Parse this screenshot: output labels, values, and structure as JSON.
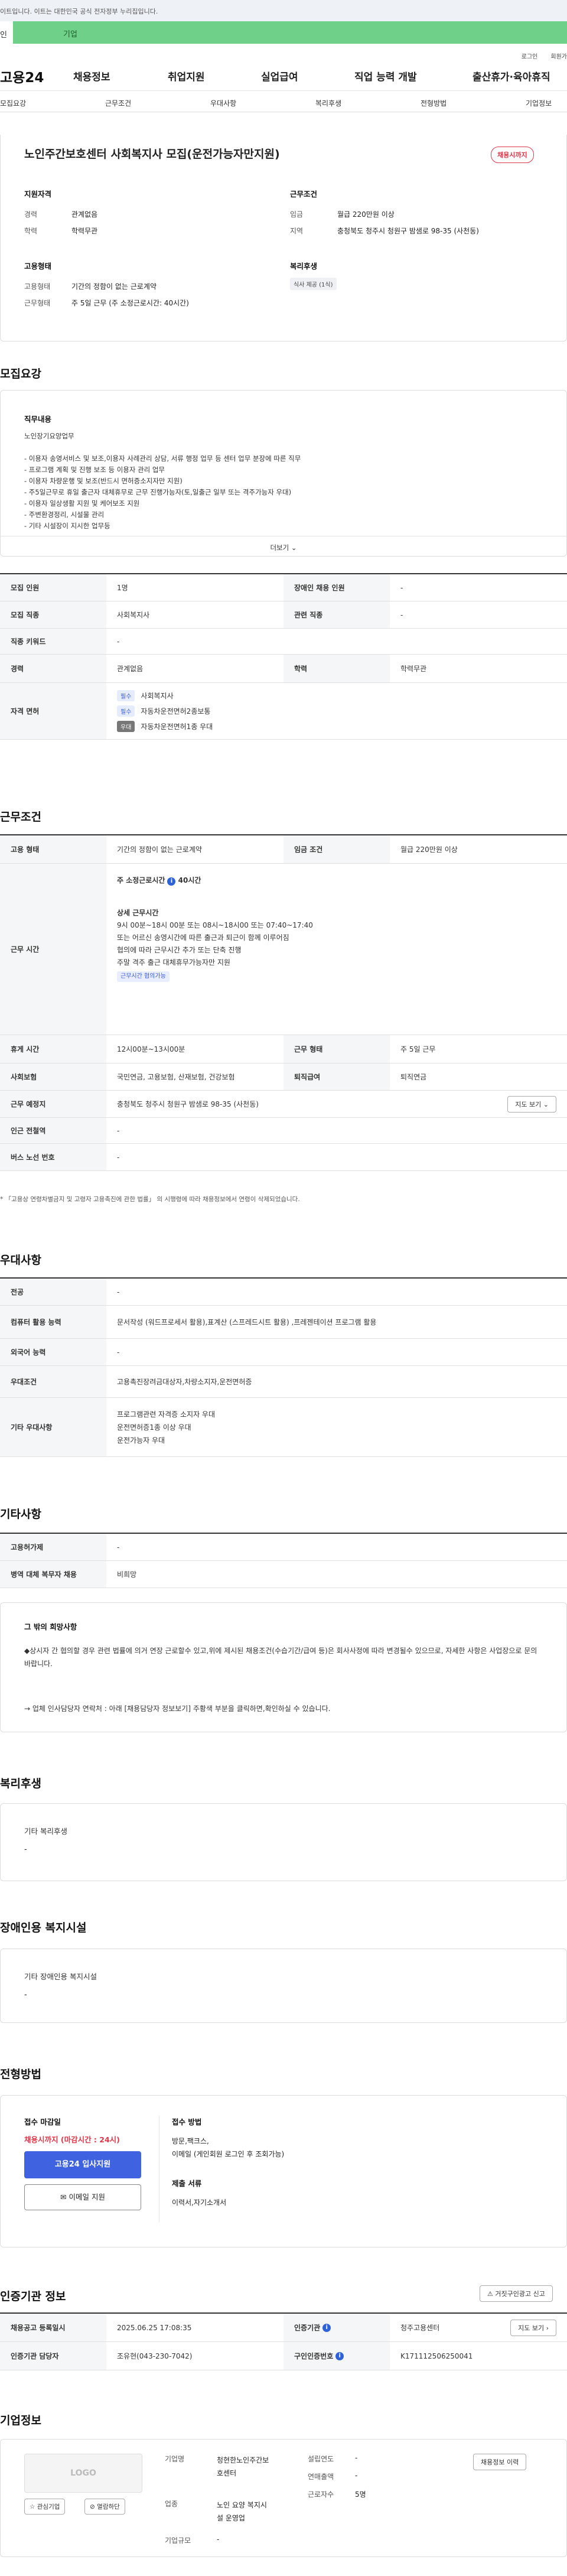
{
  "gov_notice": "이트입니다. 이트는 대한민국 공식 전자정부 누리집입니다.",
  "tabs": [
    "인",
    "기업"
  ],
  "util": [
    "로그인",
    "회원가"
  ],
  "logo": "고용24",
  "menu": [
    "채용정보",
    "취업지원",
    "실업급여",
    "직업 능력 개발",
    "출산휴가·육아휴직"
  ],
  "subnav": [
    "모집요강",
    "근무조건",
    "우대사항",
    "복리후생",
    "전형방법",
    "기업정보"
  ],
  "job": {
    "title": "노인주간보호센터 사회복지사 모집(운전가능자만지원)",
    "badge": "채용시까지",
    "qual_title": "지원자격",
    "career_label": "경력",
    "career": "관계없음",
    "edu_label": "학력",
    "edu": "학력무관",
    "emp_title": "고용형태",
    "emp_label": "고용형태",
    "emp": "기간의 정함이 없는 근로계약",
    "work_label": "근무형태",
    "work": "주 5일 근무 (주 소정근로시간: 40시간)",
    "cond_title": "근무조건",
    "wage_label": "임금",
    "wage": "월급 220만원 이상",
    "loc_label": "지역",
    "loc": "충청북도 청주시 청원구 밤샘로 98-35 (사천동)",
    "welfare_title": "복리후생",
    "welfare_tag": "식사 제공 (1식)"
  },
  "s_recruit": "모집요강",
  "duty": {
    "title": "직무내용",
    "lines": [
      "노인장기요양업무",
      "- 이용자 송영서비스 및 보조,이용자 사례관리 상담, 서류 행정 업무 등 센터 업무 분장에 따른 직무",
      "- 프로그램 계획 및 진행 보조 등 이용자 관리 업무",
      "- 이용자 차량운행 및 보조(반드시 면허증소지자만 지원)",
      "- 주5일근무로 휴일 출근자 대체휴무로 근무 진행가능자(토,일출근 일부 또는 격주가능자 우대)",
      "- 이용자 일상생활 지원 및 케어보조 지원",
      "- 주변환경정리, 시설물 관리",
      "- 기타 시설장이 지시한 업무등"
    ],
    "more": "더보기"
  },
  "req": {
    "count_l": "모집 인원",
    "count": "1명",
    "dis_l": "장애인 채용 인원",
    "dis": "-",
    "job_l": "모집 직종",
    "job": "사회복지사",
    "rel_l": "관련 직종",
    "rel": "-",
    "kw_l": "직종 키워드",
    "kw": "-",
    "car_l": "경력",
    "car": "관계없음",
    "edu_l": "학력",
    "edu": "학력무관",
    "lic_l": "자격 면허",
    "lic": [
      {
        "tag": "필수",
        "name": "사회복지사"
      },
      {
        "tag": "필수",
        "name": "자동차운전면허2종보통"
      },
      {
        "tag": "우대",
        "name": "자동차운전면허1종 우대"
      }
    ]
  },
  "s_cond": "근무조건",
  "cond": {
    "emp_l": "고용 형태",
    "emp": "기간의 정함이 없는 근로계약",
    "wage_l": "임금 조건",
    "wage": "월급 220만원 이상",
    "time_l": "근무 시간",
    "hours_title": "주 소정근로시간",
    "hours_val": "40시간",
    "detail_title": "상세 근무시간",
    "detail": [
      "9시 00분~18시 00분 또는 08시~18시00 또는 07:40~17:40",
      "또는 어르신 송영시간에 따른 출근과 퇴근이 함께 이루어짐",
      "협의에 따라 근무시간 추가 또는 단축 진행",
      "주말 격주 출근 대체휴무가능자만 지원"
    ],
    "hours_tag": "근무시간 협의가능",
    "rest_l": "휴게 시간",
    "rest": "12시00분~13시00분",
    "form_l": "근무 형태",
    "form": "주 5일 근무",
    "ins_l": "사회보험",
    "ins": "국민연금, 고용보험, 산재보험, 건강보험",
    "ret_l": "퇴직급여",
    "ret": "퇴직연금",
    "place_l": "근무 예정지",
    "place": "충청북도 청주시 청원구 밤샘로 98-35 (사천동)",
    "map": "지도 보기",
    "sub_l": "인근 전철역",
    "sub": "-",
    "bus_l": "버스 노선 번호",
    "bus": "-",
    "note": "* 「고용상 연령차별금지 및 고령자 고용촉진에 관한 법률」 의 시행령에 따라 채용정보에서 연령이 삭제되었습니다."
  },
  "s_pref": "우대사항",
  "pref": {
    "major_l": "전공",
    "major": "-",
    "pc_l": "컴퓨터 활용 능력",
    "pc": "문서작성 (워드프로세서 활용),표계산 (스프레드시트 활용) ,프레젠테이션 프로그램 활용",
    "lang_l": "외국어 능력",
    "lang": "-",
    "cond_l": "우대조건",
    "cond": "고용촉진장려금대상자,차량소지자,운전면허증",
    "etc_l": "기타 우대사항",
    "etc": [
      "프로그램관련 자격증 소지자 우대",
      "운전면허증1종 이상 우대",
      "운전가능자 우대"
    ]
  },
  "s_etc": "기타사항",
  "etc": {
    "ins_l": "고용허가제",
    "ins": "-",
    "mil_l": "병역 대체 복무자 채용",
    "mil": "비희망",
    "wish_title": "그 밖의 희망사항",
    "wish1": "◆상시자 간 협의할 경우 관련 법률에 의거 연장 근로할수 있고,위에 제시된 채용조건(수습기간/급여 등)은 회사사정에 따라 변경될수 있으므로, 자세한 사항은 사업장으로 문의 바랍니다.",
    "wish2": "→ 업체 인사담당자 연락처 :  아래 [채용담당자 정보보기] 주황색 부분을 클릭하면,확인하실 수 있습니다."
  },
  "s_welf": "복리후생",
  "welf": {
    "title": "기타 복리후생",
    "val": "-"
  },
  "s_dis": "장애인용 복지시설",
  "dis": {
    "title": "기타 장애인용 복지시설",
    "val": "-"
  },
  "s_proc": "전형방법",
  "proc": {
    "deadline_l": "접수 마감일",
    "deadline": "채용시까지 (마감시간 : 24시)",
    "apply": "고용24 입사지원",
    "email": "이메일 지원",
    "method_l": "접수 방법",
    "method": [
      "방문,팩크스,",
      "이메일 (게인회원 로그인 후 조회가능)"
    ],
    "docs_l": "제출 서류",
    "docs": "이력서,자기소개서"
  },
  "s_org": "인증기관 정보",
  "report": "거짓구인광고 신고",
  "org": {
    "reg_l": "채용공고 등록일시",
    "reg": "2025.06.25 17:08:35",
    "agency_l": "인증기관",
    "agency": "청주고용센터",
    "map": "지도 보기",
    "mgr_l": "인증기관 담당자",
    "mgr": "조유현(043-230-7042)",
    "no_l": "구인인증번호",
    "no": "K171112506250041"
  },
  "s_comp": "기업정보",
  "comp": {
    "logo": "LOGO",
    "fav": "관심기업",
    "fav2": "열람하단",
    "name_l": "기업명",
    "name": [
      "청현한노인주간보",
      "호센터"
    ],
    "est_l": "설립연도",
    "est": "-",
    "sales_l": "연매출액",
    "sales": "-",
    "ind_l": "업종",
    "ind": [
      "노인 요양 복지시",
      "설 운영업"
    ],
    "emp_l": "근로자수",
    "emp": "5명",
    "size_l": "기업규모",
    "size": "-",
    "btn": "채용정보 이력"
  }
}
